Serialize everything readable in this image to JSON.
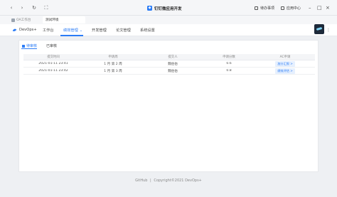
{
  "topbar": {
    "title": "钉钉微应用开发",
    "actions": [
      {
        "label": "待办事项",
        "icon": "todo-icon"
      },
      {
        "label": "应用中心",
        "icon": "app-center-icon"
      }
    ],
    "nav_icons": [
      "back-icon",
      "forward-icon",
      "refresh-icon",
      "fullscreen-icon"
    ],
    "window_controls": [
      "minimize-icon",
      "maximize-icon",
      "close-icon"
    ]
  },
  "browser_tabs": [
    {
      "label": "OA工作台",
      "active": false
    },
    {
      "label": "测试环境",
      "active": true
    }
  ],
  "appnav": {
    "brand": "DevOps+",
    "items": [
      {
        "label": "工作台",
        "active": false,
        "dropdown": false
      },
      {
        "label": "绩效管理",
        "active": true,
        "dropdown": true
      },
      {
        "label": "开发管理",
        "active": false,
        "dropdown": false
      },
      {
        "label": "论文管理",
        "active": false,
        "dropdown": false
      },
      {
        "label": "系统设置",
        "active": false,
        "dropdown": false
      }
    ],
    "more": "⋮"
  },
  "subtabs": [
    {
      "label": "待审核",
      "active": true
    },
    {
      "label": "已审核",
      "active": false
    }
  ],
  "table": {
    "columns": [
      "提交时间",
      "申请周",
      "提交人",
      "申请分数",
      "AC申请"
    ],
    "rows": [
      {
        "time": "2021-01-11 23:41",
        "week": "1 月 第 2 周",
        "user": "魏伯伯",
        "score": "0.6",
        "action": "加分汇报 >"
      },
      {
        "time": "2021-01-11 23:42",
        "week": "1 月 第 3 周",
        "user": "魏伯伯",
        "score": "0.8",
        "action": "绩效评估 >"
      }
    ]
  },
  "footer": {
    "link": "GitHub",
    "sep": "|",
    "copyright": "Copyright©2021 DevOps+"
  },
  "colors": {
    "accent": "#2b7cf6",
    "bg": "#eef0f3"
  }
}
